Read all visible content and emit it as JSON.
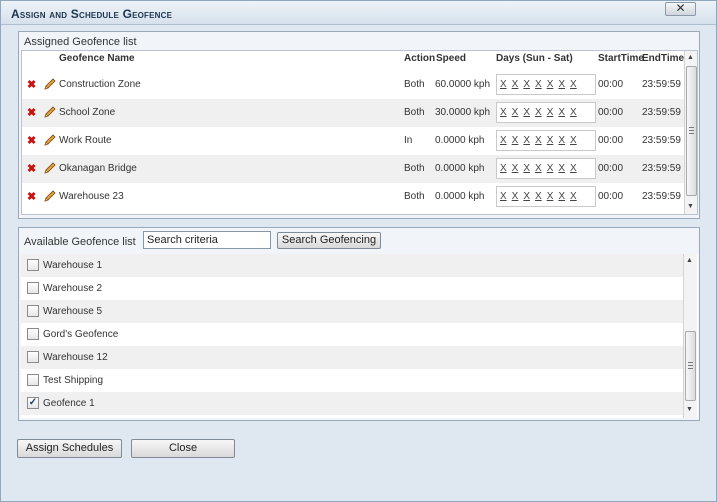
{
  "dialog": {
    "title": "Assign and Schedule Geofence",
    "close_icon": "close-x-icon"
  },
  "assigned": {
    "panel_title": "Assigned Geofence list",
    "headers": {
      "name": "Geofence Name",
      "action": "Action",
      "speed": "Speed",
      "days": "Days (Sun - Sat)",
      "start": "StartTime",
      "end": "EndTime"
    },
    "rows": [
      {
        "name": "Construction Zone",
        "action": "Both",
        "speed": "60.0000 kph",
        "start": "00:00",
        "end": "23:59:59"
      },
      {
        "name": "School Zone",
        "action": "Both",
        "speed": "30.0000 kph",
        "start": "00:00",
        "end": "23:59:59"
      },
      {
        "name": "Work Route",
        "action": "In",
        "speed": "0.0000 kph",
        "start": "00:00",
        "end": "23:59:59"
      },
      {
        "name": "Okanagan Bridge",
        "action": "Both",
        "speed": "0.0000 kph",
        "start": "00:00",
        "end": "23:59:59"
      },
      {
        "name": "Warehouse 23",
        "action": "Both",
        "speed": "0.0000 kph",
        "start": "00:00",
        "end": "23:59:59"
      }
    ],
    "day_mark": "X"
  },
  "available": {
    "panel_title": "Available Geofence list",
    "search_value": "Search criteria",
    "search_button": "Search Geofencing",
    "items": [
      {
        "label": "Warehouse 1",
        "checked": false
      },
      {
        "label": "Warehouse 2",
        "checked": false
      },
      {
        "label": "Warehouse 5",
        "checked": false
      },
      {
        "label": "Gord's Geofence",
        "checked": false
      },
      {
        "label": "Warehouse 12",
        "checked": false
      },
      {
        "label": "Test Shipping",
        "checked": false
      },
      {
        "label": "Geofence 1",
        "checked": true
      }
    ]
  },
  "footer": {
    "assign_button": "Assign Schedules",
    "close_button": "Close"
  },
  "icons": {
    "delete": "delete-x-icon",
    "edit": "pencil-edit-icon",
    "check": "checkmark-icon"
  },
  "colors": {
    "delete_red": "#cc1111",
    "titlebar_text": "#1d3550",
    "panel_bg": "#f1f5f9",
    "alt_row": "#f0f0f0"
  }
}
